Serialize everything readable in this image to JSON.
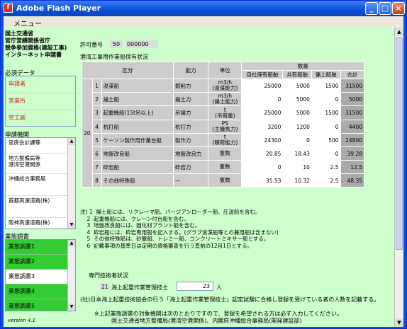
{
  "window": {
    "title": "Adobe Flash Player"
  },
  "menu": {
    "label": "メニュー"
  },
  "org": {
    "line1": "国土交通省",
    "line2": "官庁営繕関係省庁",
    "line3": "競争参加資格(建設工事)",
    "line4": "インターネット申請書"
  },
  "required": {
    "title": "必須データ",
    "items": [
      "申請者",
      "営業所",
      "完工高"
    ]
  },
  "agencies": {
    "title": "申請機関",
    "items": [
      "官房会計課等",
      "地方整備局等\n港湾空港関係",
      "沖縄総合事務局",
      "首都高速道路(株)",
      "阪神高速道路(株)"
    ]
  },
  "reports": {
    "title": "業態調書",
    "items": [
      "業態調書1",
      "業態調書2",
      "業態調書3",
      "業態調書4",
      "業態調書5"
    ]
  },
  "version": "version 4.1",
  "permit": {
    "label": "許可番号",
    "prefix": "50",
    "number": "000000"
  },
  "table": {
    "title": "港湾工事用作業船保有状況",
    "headers": {
      "category": "区分",
      "capacity": "能力",
      "unit": "単位",
      "quantity": "数量",
      "own": "自社保有船舶",
      "shared": "共有船舶",
      "leased": "傭上船舶",
      "total": "合計"
    },
    "row_group_label": "20",
    "rows": [
      {
        "no": "1",
        "name": "浚渫船",
        "capacity": "掘削力",
        "unit": "m3/h\n(浚渫能力)",
        "own": "25000",
        "shared": "5000",
        "leased": "1500",
        "total": "31500"
      },
      {
        "no": "2",
        "name": "揚土船",
        "capacity": "揚土力",
        "unit": "m3/h\n(揚土能力)",
        "own": "0",
        "shared": "5000",
        "leased": "0",
        "total": "5000"
      },
      {
        "no": "3",
        "name": "起重機船(15t吊以上)",
        "capacity": "吊揚力",
        "unit": "t\n(吊荷重)",
        "own": "25000",
        "shared": "5000",
        "leased": "1500",
        "total": "31500"
      },
      {
        "no": "4",
        "name": "杭打船",
        "capacity": "杭打力",
        "unit": "PS\n(主機馬力)",
        "own": "3200",
        "shared": "1200",
        "leased": "0",
        "total": "4400"
      },
      {
        "no": "5",
        "name": "ケーソン製作用作業台船",
        "capacity": "製作力",
        "unit": "t\n(積荷能力)",
        "own": "24300",
        "shared": "0",
        "leased": "500",
        "total": "24800"
      },
      {
        "no": "6",
        "name": "地盤改良船",
        "capacity": "地盤改良力",
        "unit": "隻数",
        "own": "20.85",
        "shared": "18.43",
        "leased": "0",
        "total": "39.28"
      },
      {
        "no": "7",
        "name": "砕岩船",
        "capacity": "砕岩力",
        "unit": "隻数",
        "own": "0",
        "shared": "10",
        "leased": "2.5",
        "total": "12.5"
      },
      {
        "no": "8",
        "name": "その他特殊船",
        "capacity": "—",
        "unit": "隻数",
        "own": "35.53",
        "shared": "10.32",
        "leased": "2.5",
        "total": "48.35"
      }
    ]
  },
  "notes": [
    "注) 1  揚土船には、リクレーマ船、バージアンローダー船、圧送船を含む。",
    "    2  起重機船には、クレーン付台船を含む。",
    "    3  地盤改良船には、固化材プラント船を含む。",
    "    4  砕岩船には、砕岩専用船を記入する。(グラブ浚渫船等との兼用船は含まない)",
    "    5  その他特殊船は、砂撒船、トレミー船、コンクリートミキサー船とする。",
    "    6  記載事項の基準日は定期の資格審査を行う直前の12月1日とする。"
  ],
  "specialist": {
    "label": "専門技術者状況",
    "code": "21",
    "name": "海上起重作業管理技士",
    "count": "23",
    "unit": "人",
    "note": "(社)日本海上起重技術協会の行う「海上起重作業管理技士」認定試験に合格し登録を受けている者の人数を記載する。"
  },
  "footer": {
    "line1": "※上記業態調書の対象機関は次のとおりですので、登録を希望される方は必ず入力してください。",
    "line2": "国土交通省地方整備局(港湾空港関係)、内閣府沖縄総合事務局(開発建設部)"
  }
}
